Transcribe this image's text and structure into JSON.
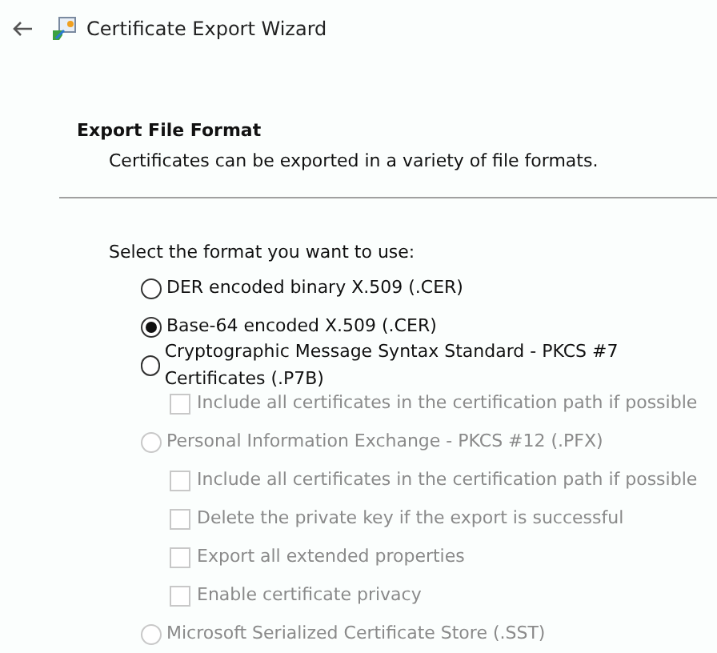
{
  "window": {
    "title": "Certificate Export Wizard"
  },
  "section": {
    "heading": "Export File Format",
    "description": "Certificates can be exported in a variety of file formats."
  },
  "prompt": "Select the format you want to use:",
  "options": [
    {
      "kind": "radio",
      "label": "DER encoded binary X.509 (.CER)",
      "selected": false,
      "disabled": false
    },
    {
      "kind": "radio",
      "label": "Base-64 encoded X.509 (.CER)",
      "selected": true,
      "disabled": false
    },
    {
      "kind": "radio",
      "label": "Cryptographic Message Syntax Standard - PKCS #7 Certificates (.P7B)",
      "selected": false,
      "disabled": false
    },
    {
      "kind": "checkbox",
      "label": "Include all certificates in the certification path if possible",
      "checked": false,
      "disabled": true
    },
    {
      "kind": "radio",
      "label": "Personal Information Exchange - PKCS #12 (.PFX)",
      "selected": false,
      "disabled": true
    },
    {
      "kind": "checkbox",
      "label": "Include all certificates in the certification path if possible",
      "checked": false,
      "disabled": true
    },
    {
      "kind": "checkbox",
      "label": "Delete the private key if the export is successful",
      "checked": false,
      "disabled": true
    },
    {
      "kind": "checkbox",
      "label": "Export all extended properties",
      "checked": false,
      "disabled": true
    },
    {
      "kind": "checkbox",
      "label": "Enable certificate privacy",
      "checked": false,
      "disabled": true
    },
    {
      "kind": "radio",
      "label": "Microsoft Serialized Certificate Store (.SST)",
      "selected": false,
      "disabled": true
    }
  ]
}
